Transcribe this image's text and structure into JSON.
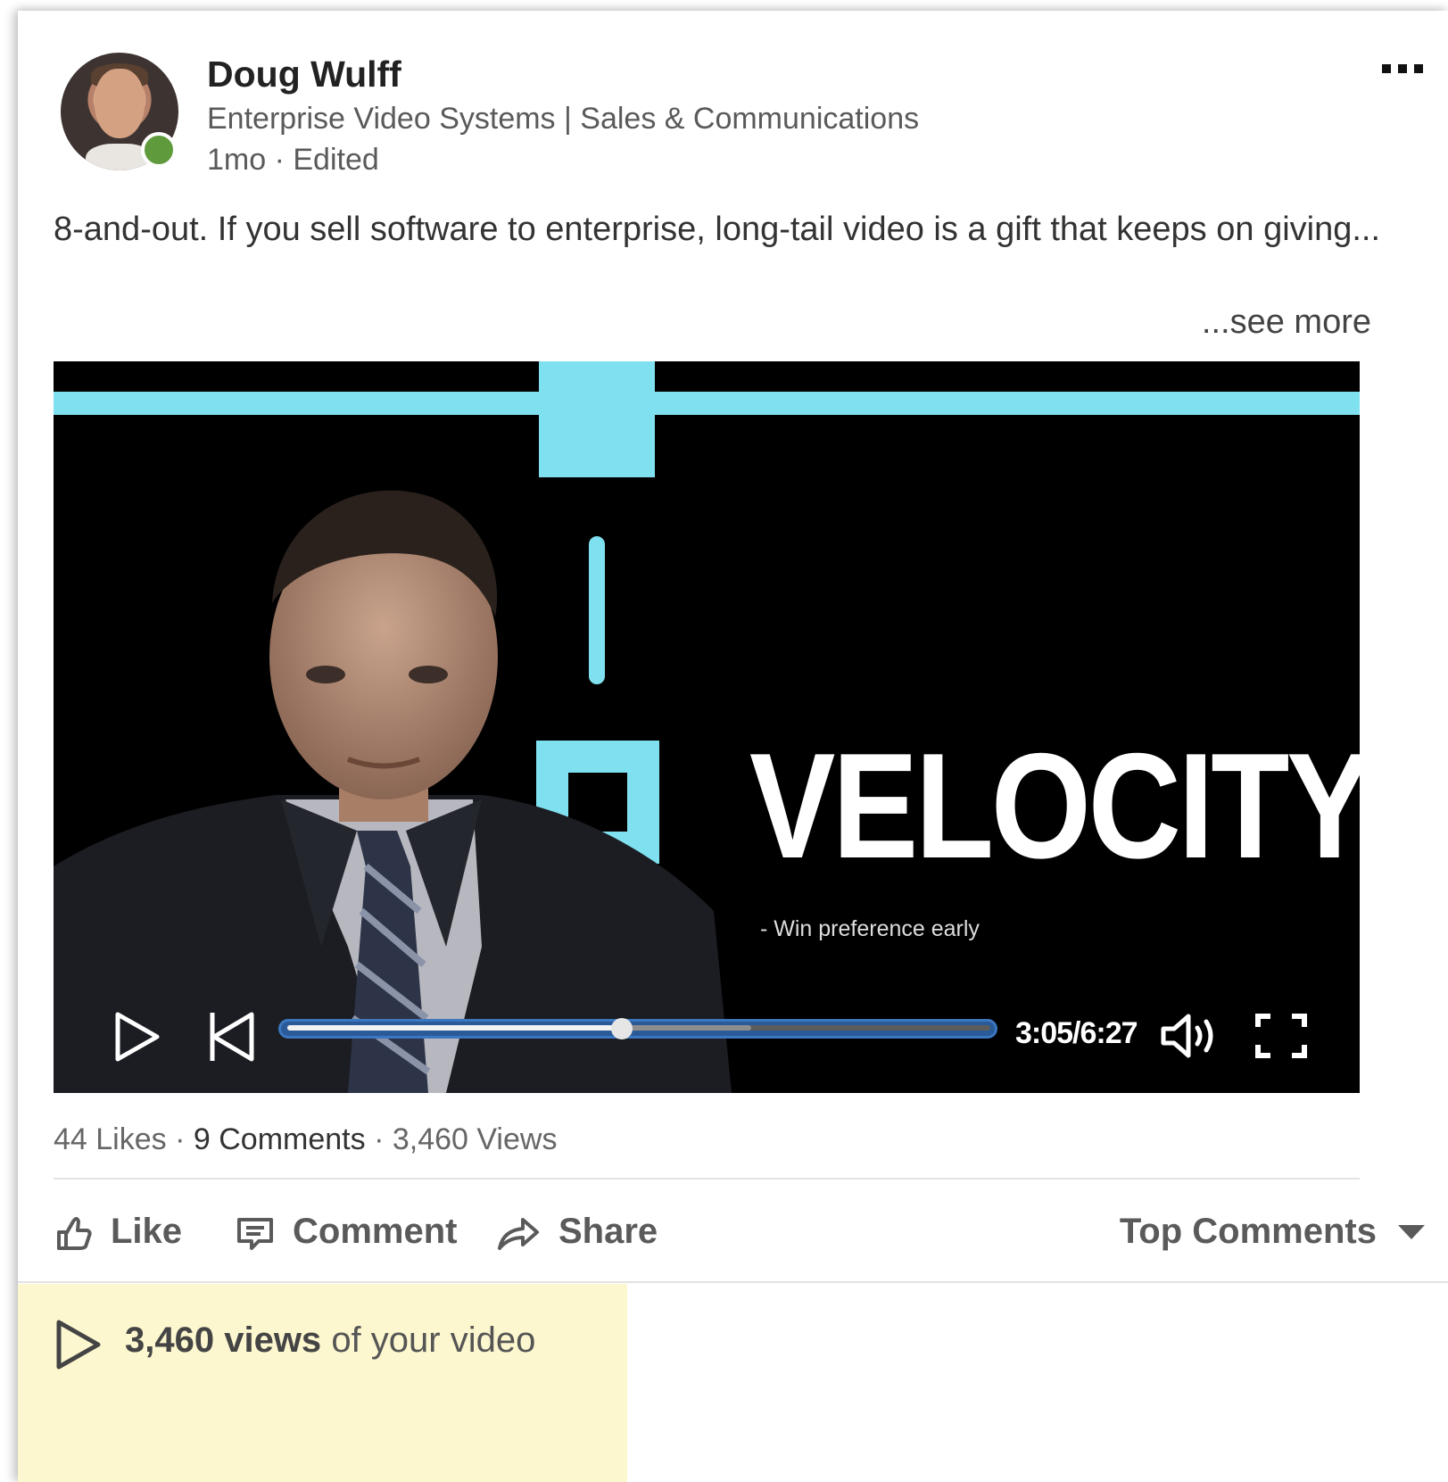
{
  "post": {
    "author_name": "Doug Wulff",
    "author_headline": "Enterprise Video Systems | Sales & Communications",
    "meta": "1mo · Edited",
    "text": "8-and-out. If you sell software to enterprise, long-tail video is a gift that keeps on giving...",
    "see_more": "...see more"
  },
  "video": {
    "overlay_title": "VELOCITY",
    "overlay_subtitle": "- Win preference early",
    "time_display": "3:05/6:27",
    "progress": 0.476,
    "buffered": 0.66
  },
  "stats": {
    "likes": "44 Likes",
    "comments": "9 Comments",
    "views": "3,460 Views",
    "sep": "·"
  },
  "actions": {
    "like": "Like",
    "comment": "Comment",
    "share": "Share",
    "sort": "Top Comments"
  },
  "views_banner": {
    "count": "3,460 views",
    "suffix": "of your video"
  },
  "colors": {
    "accent_cyan": "#7fe0ef",
    "online": "#5f9b3d",
    "progress_blue": "#2a5a97",
    "views_bg": "#fdf7cf"
  },
  "icons": [
    "more-icon",
    "play-icon",
    "restart-icon",
    "volume-icon",
    "fullscreen-icon",
    "like-icon",
    "comment-icon",
    "share-icon",
    "caret-down-icon",
    "views-play-icon"
  ]
}
